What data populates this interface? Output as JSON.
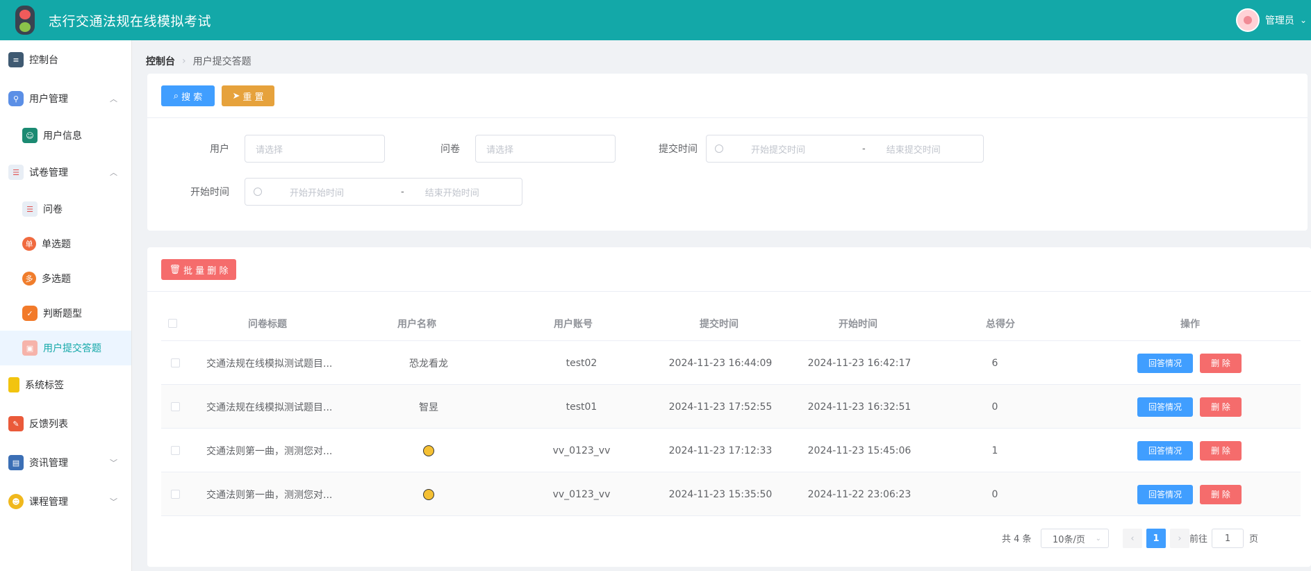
{
  "app": {
    "title": "志行交通法规在线模拟考试",
    "user": "管理员"
  },
  "sidebar": {
    "items": [
      {
        "label": "控制台"
      },
      {
        "label": "用户管理"
      },
      {
        "label": "用户信息"
      },
      {
        "label": "试卷管理"
      },
      {
        "label": "问卷"
      },
      {
        "label": "单选题",
        "badge": "单"
      },
      {
        "label": "多选题",
        "badge": "多"
      },
      {
        "label": "判断题型"
      },
      {
        "label": "用户提交答题"
      },
      {
        "label": "系统标签"
      },
      {
        "label": "反馈列表"
      },
      {
        "label": "资讯管理"
      },
      {
        "label": "课程管理"
      }
    ]
  },
  "breadcrumb": {
    "root": "控制台",
    "current": "用户提交答题"
  },
  "search": {
    "search_btn": "搜 索",
    "reset_btn": "重 置",
    "user_label": "用户",
    "user_placeholder": "请选择",
    "paper_label": "问卷",
    "paper_placeholder": "请选择",
    "submit_label": "提交时间",
    "submit_start": "开始提交时间",
    "submit_end": "结束提交时间",
    "start_label": "开始时间",
    "start_start": "开始开始时间",
    "start_end": "结束开始时间",
    "dash": "-"
  },
  "table": {
    "batch_delete": "批 量 删 除",
    "columns": [
      "问卷标题",
      "用户名称",
      "用户账号",
      "提交时间",
      "开始时间",
      "总得分",
      "操作"
    ],
    "rows": [
      {
        "title": "交通法规在线模拟测试题目...",
        "name": "恐龙看龙",
        "account": "test02",
        "submit": "2024-11-23 16:44:09",
        "start": "2024-11-23 16:42:17",
        "score": "6"
      },
      {
        "title": "交通法规在线模拟测试题目...",
        "name": "智昱",
        "account": "test01",
        "submit": "2024-11-23 17:52:55",
        "start": "2024-11-23 16:32:51",
        "score": "0"
      },
      {
        "title": "交通法则第一曲，测测您对...",
        "name": "",
        "account": "vv_0123_vv",
        "submit": "2024-11-23 17:12:33",
        "start": "2024-11-23 15:45:06",
        "score": "1"
      },
      {
        "title": "交通法则第一曲，测测您对...",
        "name": "",
        "account": "vv_0123_vv",
        "submit": "2024-11-23 15:35:50",
        "start": "2024-11-22 23:06:23",
        "score": "0"
      }
    ],
    "answer_btn": "回答情况",
    "delete_btn": "删 除"
  },
  "pagination": {
    "total": "共 4 条",
    "page_size": "10条/页",
    "current": "1",
    "goto_prefix": "前往",
    "goto_value": "1",
    "goto_suffix": "页"
  }
}
